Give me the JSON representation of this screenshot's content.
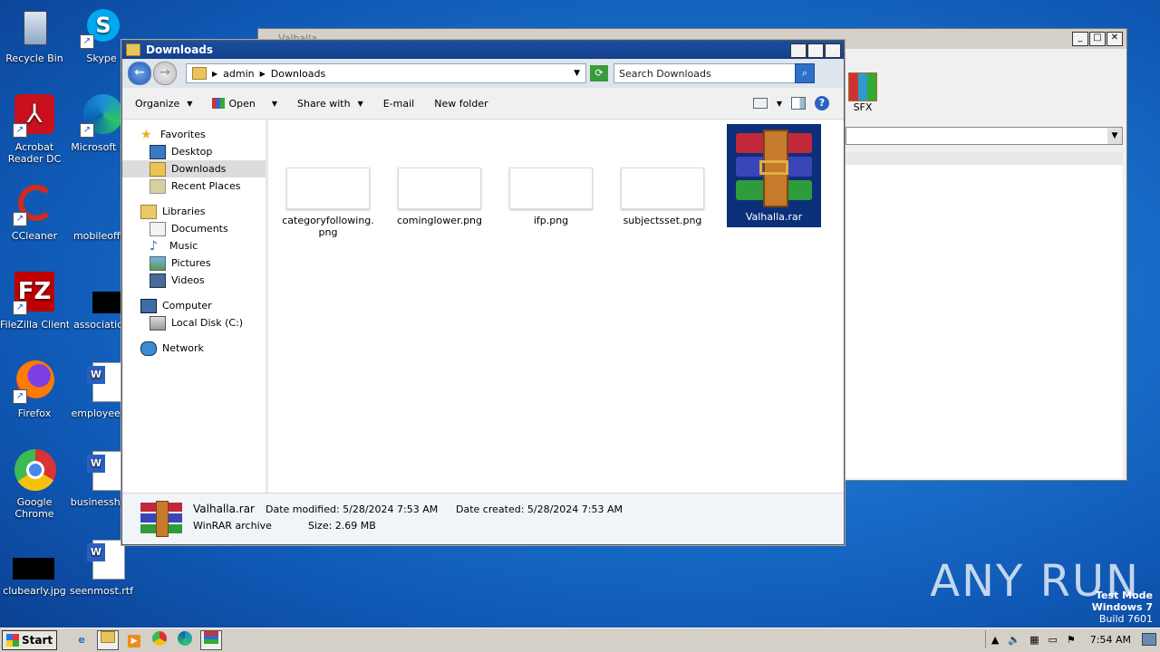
{
  "desktop": {
    "icons": [
      {
        "label": "Recycle Bin"
      },
      {
        "label": "Skype"
      },
      {
        "label": "Acrobat Reader DC"
      },
      {
        "label": "Microsoft Ed"
      },
      {
        "label": "CCleaner"
      },
      {
        "label": "mobileoff.p"
      },
      {
        "label": "FileZilla Client"
      },
      {
        "label": "association"
      },
      {
        "label": "Firefox"
      },
      {
        "label": "employeesh"
      },
      {
        "label": "Google Chrome"
      },
      {
        "label": "businesshea"
      },
      {
        "label": "clubearly.jpg"
      },
      {
        "label": "seenmost.rtf"
      }
    ]
  },
  "bg_window": {
    "title": "Valhalla",
    "sfx_label": "SFX"
  },
  "explorer": {
    "title": "Downloads",
    "breadcrumb": [
      "admin",
      "Downloads"
    ],
    "search_placeholder": "Search Downloads",
    "commands": {
      "organize": "Organize",
      "open": "Open",
      "share": "Share with",
      "email": "E-mail",
      "new_folder": "New folder"
    },
    "nav": {
      "favorites": "Favorites",
      "desktop": "Desktop",
      "downloads": "Downloads",
      "recent": "Recent Places",
      "libraries": "Libraries",
      "documents": "Documents",
      "music": "Music",
      "pictures": "Pictures",
      "videos": "Videos",
      "computer": "Computer",
      "local_disk": "Local Disk (C:)",
      "network": "Network"
    },
    "files": [
      {
        "name": "categoryfollowing.png"
      },
      {
        "name": "cominglower.png"
      },
      {
        "name": "ifp.png"
      },
      {
        "name": "subjectsset.png"
      },
      {
        "name": "Valhalla.rar"
      }
    ],
    "details": {
      "name": "Valhalla.rar",
      "type": "WinRAR archive",
      "modified": "Date modified: 5/28/2024 7:53 AM",
      "created": "Date created: 5/28/2024 7:53 AM",
      "size": "Size: 2.69 MB"
    }
  },
  "taskbar": {
    "start": "Start",
    "time": "7:54 AM"
  },
  "watermark": {
    "line1": "Test Mode",
    "line2": "Windows 7",
    "line3": "Build 7601",
    "brand": "ANY RUN"
  },
  "colors": {
    "accent": "#123f8c",
    "selection": "#0c2f7a"
  }
}
